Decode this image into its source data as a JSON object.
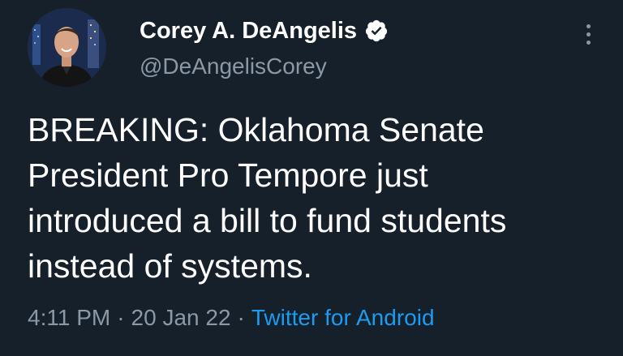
{
  "author": {
    "display_name": "Corey A. DeAngelis",
    "handle": "@DeAngelisCorey",
    "verified": true
  },
  "tweet": {
    "text_lines": [
      "BREAKING: Oklahoma Senate",
      "President Pro Tempore just",
      "introduced a bill to fund students",
      "instead of systems."
    ],
    "time": "4:11 PM",
    "separator": "·",
    "date": "20 Jan 22",
    "source": "Twitter for Android"
  },
  "icons": {
    "verified": "verified-badge-icon",
    "more": "more-vertical-icon"
  },
  "colors": {
    "background": "#15202b",
    "text": "#ffffff",
    "secondary": "#8b98a5",
    "link": "#1d9bf0"
  }
}
